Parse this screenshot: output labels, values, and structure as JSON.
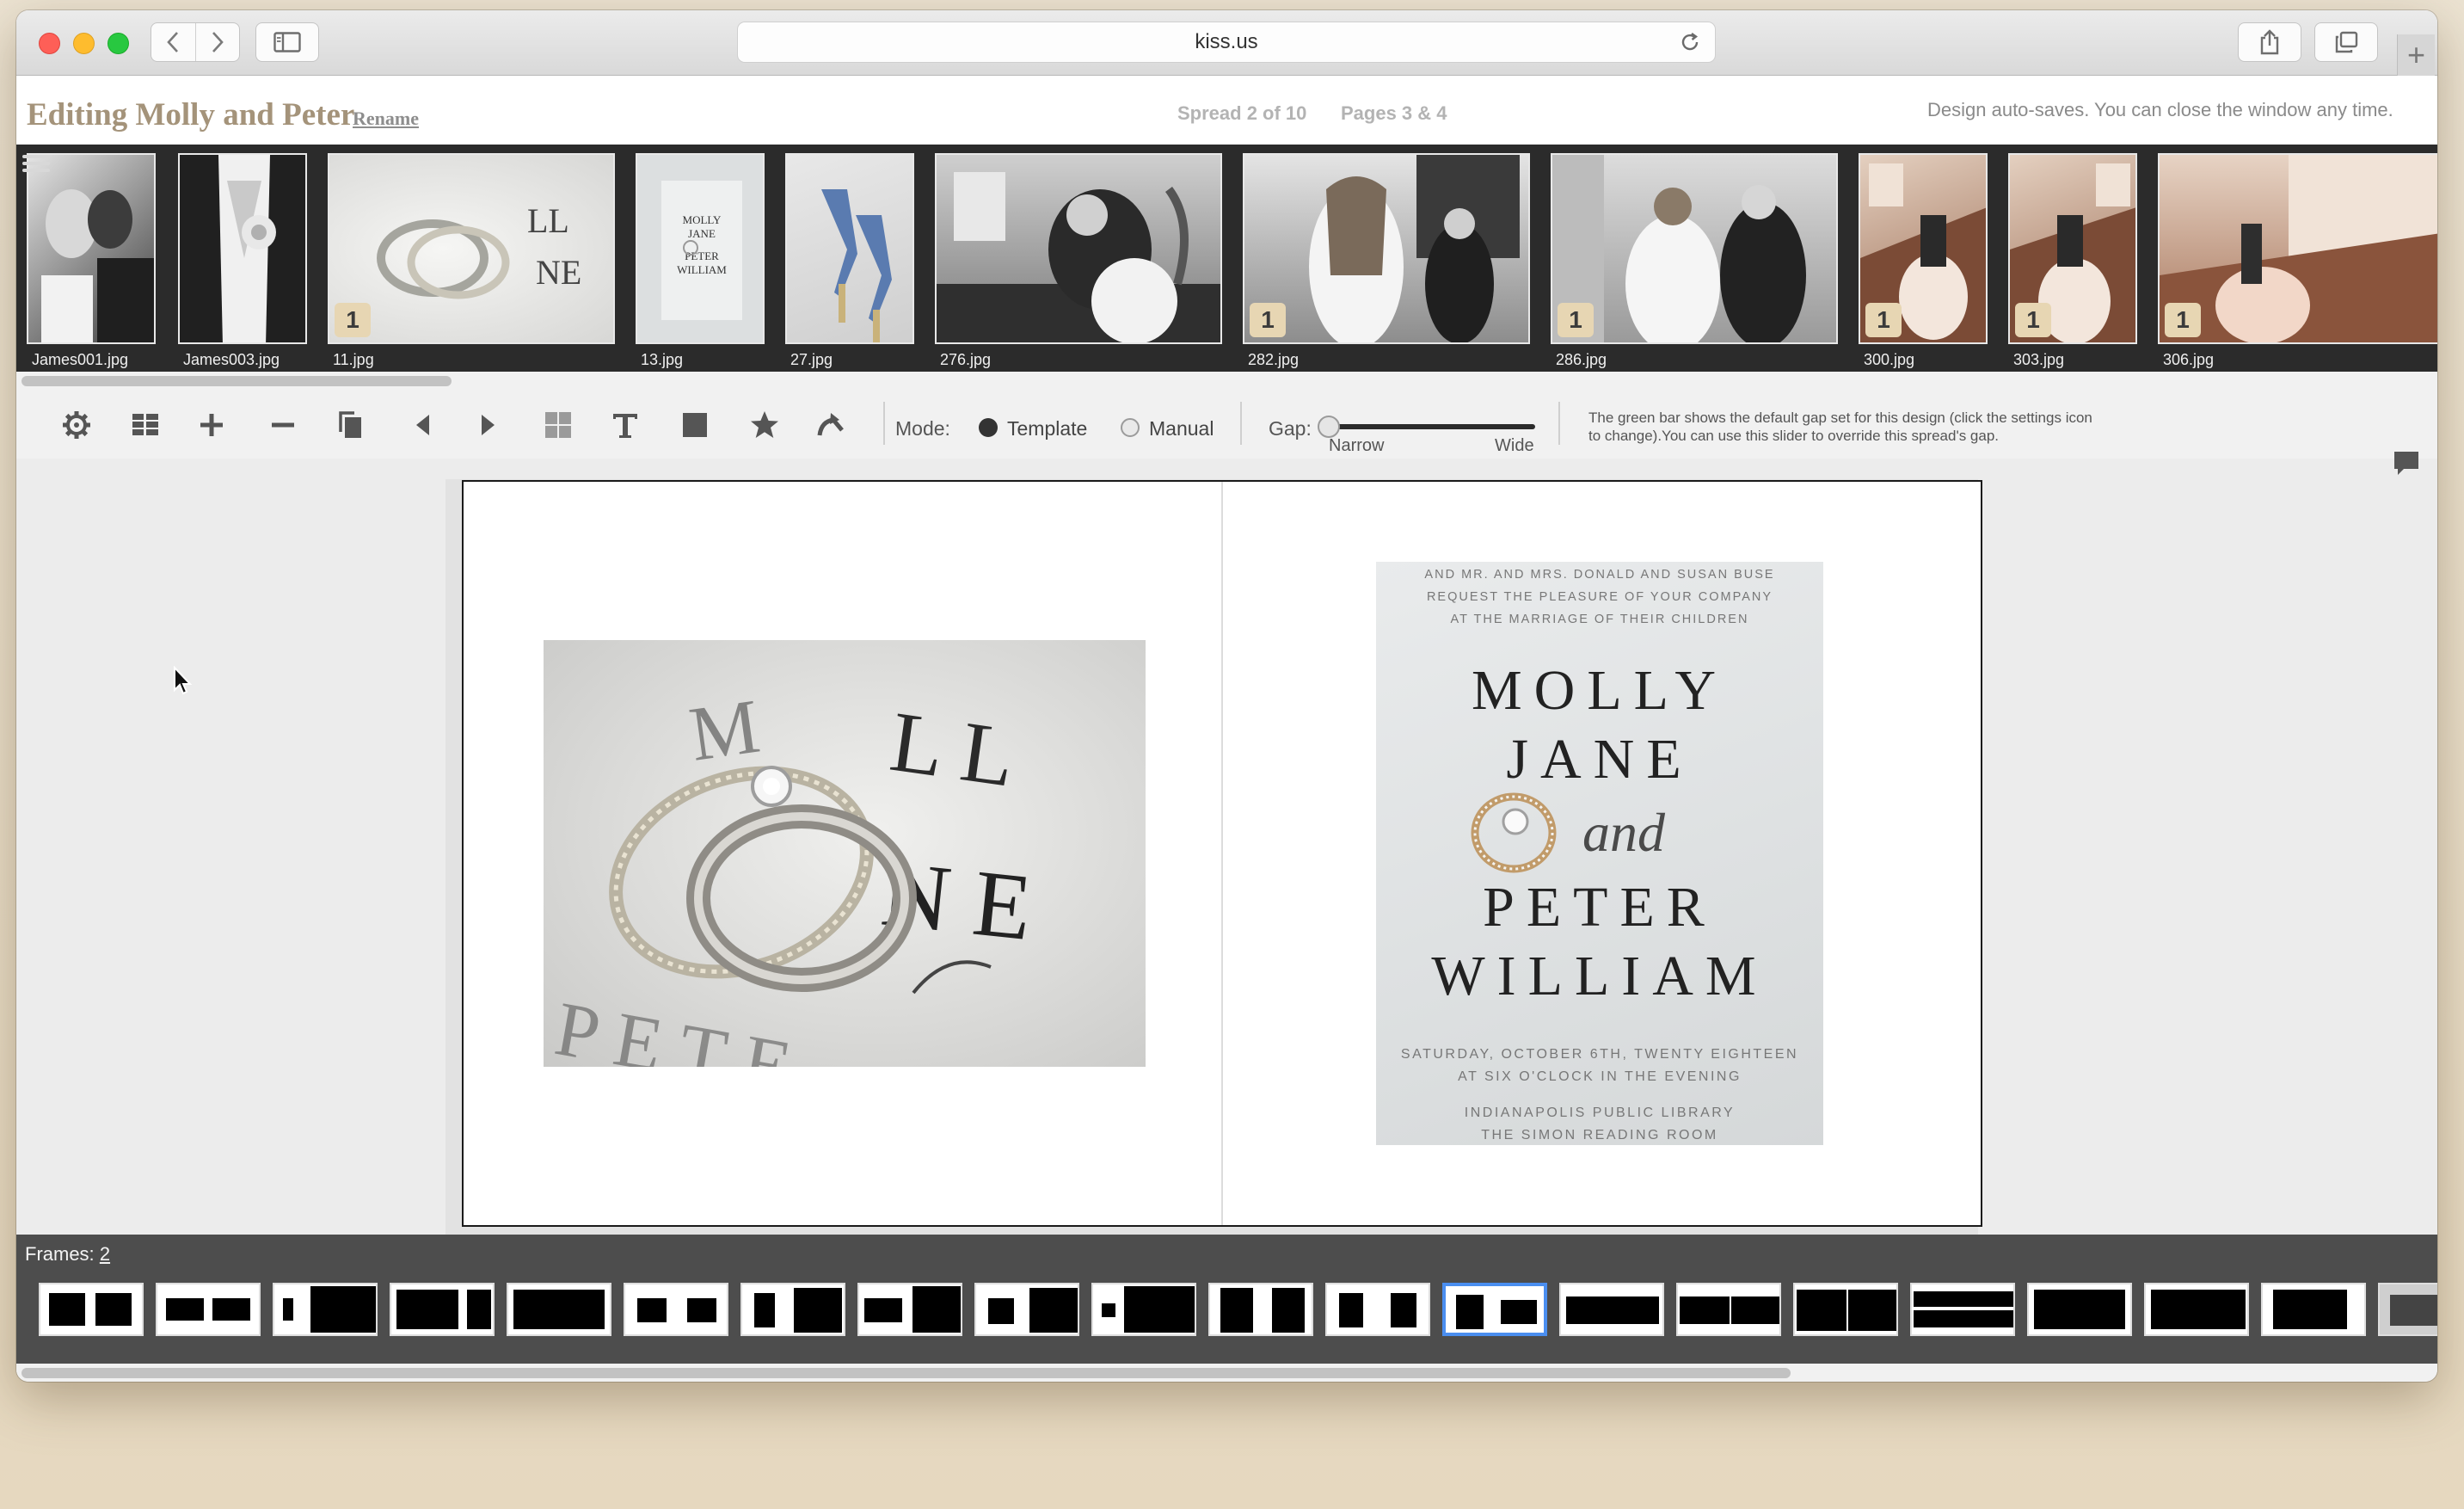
{
  "browser": {
    "address": "kiss.us"
  },
  "header": {
    "title": "Editing Molly and Peter",
    "rename_label": "Rename",
    "spread_info": "Spread 2 of 10",
    "pages_info": "Pages 3 & 4",
    "autosave_note": "Design auto-saves. You can close the window any time."
  },
  "photos": [
    {
      "name": "James001.jpg",
      "badge": ""
    },
    {
      "name": "James003.jpg",
      "badge": ""
    },
    {
      "name": "11.jpg",
      "badge": "1"
    },
    {
      "name": "13.jpg",
      "badge": ""
    },
    {
      "name": "27.jpg",
      "badge": ""
    },
    {
      "name": "276.jpg",
      "badge": ""
    },
    {
      "name": "282.jpg",
      "badge": "1"
    },
    {
      "name": "286.jpg",
      "badge": "1"
    },
    {
      "name": "300.jpg",
      "badge": "1"
    },
    {
      "name": "303.jpg",
      "badge": "1"
    },
    {
      "name": "306.jpg",
      "badge": "1"
    }
  ],
  "toolbar": {
    "icons": [
      "gear-icon",
      "grid-icon",
      "plus-icon",
      "minus-icon",
      "copy-icon",
      "triangle-left-icon",
      "triangle-right-icon",
      "layout-icon",
      "text-icon",
      "square-icon",
      "star-icon",
      "undo-icon"
    ],
    "mode_label": "Mode:",
    "mode_template": "Template",
    "mode_manual": "Manual",
    "mode_selected": "Template",
    "gap_label": "Gap:",
    "gap_narrow": "Narrow",
    "gap_wide": "Wide",
    "gap_level": 0,
    "gap_help": "The green bar shows the default gap set for this design (click the settings icon to change).You can use this slider to override this spread's gap."
  },
  "invitation": {
    "top_lines": [
      "AND MR. AND MRS. DONALD AND SUSAN BUSE",
      "REQUEST THE PLEASURE OF YOUR COMPANY",
      "AT THE MARRIAGE OF THEIR CHILDREN"
    ],
    "name1a": "MOLLY",
    "name1b": "JANE",
    "and": "and",
    "name2a": "PETER",
    "name2b": "WILLIAM",
    "date_lines": [
      "SATURDAY, OCTOBER 6TH, TWENTY EIGHTEEN",
      "AT SIX O'CLOCK IN THE EVENING"
    ],
    "venue_lines": [
      "INDIANAPOLIS PUBLIC LIBRARY",
      "THE SIMON READING ROOM"
    ]
  },
  "frames": {
    "label": "Frames:",
    "count": "2",
    "selected_index": 12
  },
  "colors": {
    "title": "#a4937a",
    "selected_border": "#4a8ef0",
    "badge": "#e7d6b3"
  }
}
